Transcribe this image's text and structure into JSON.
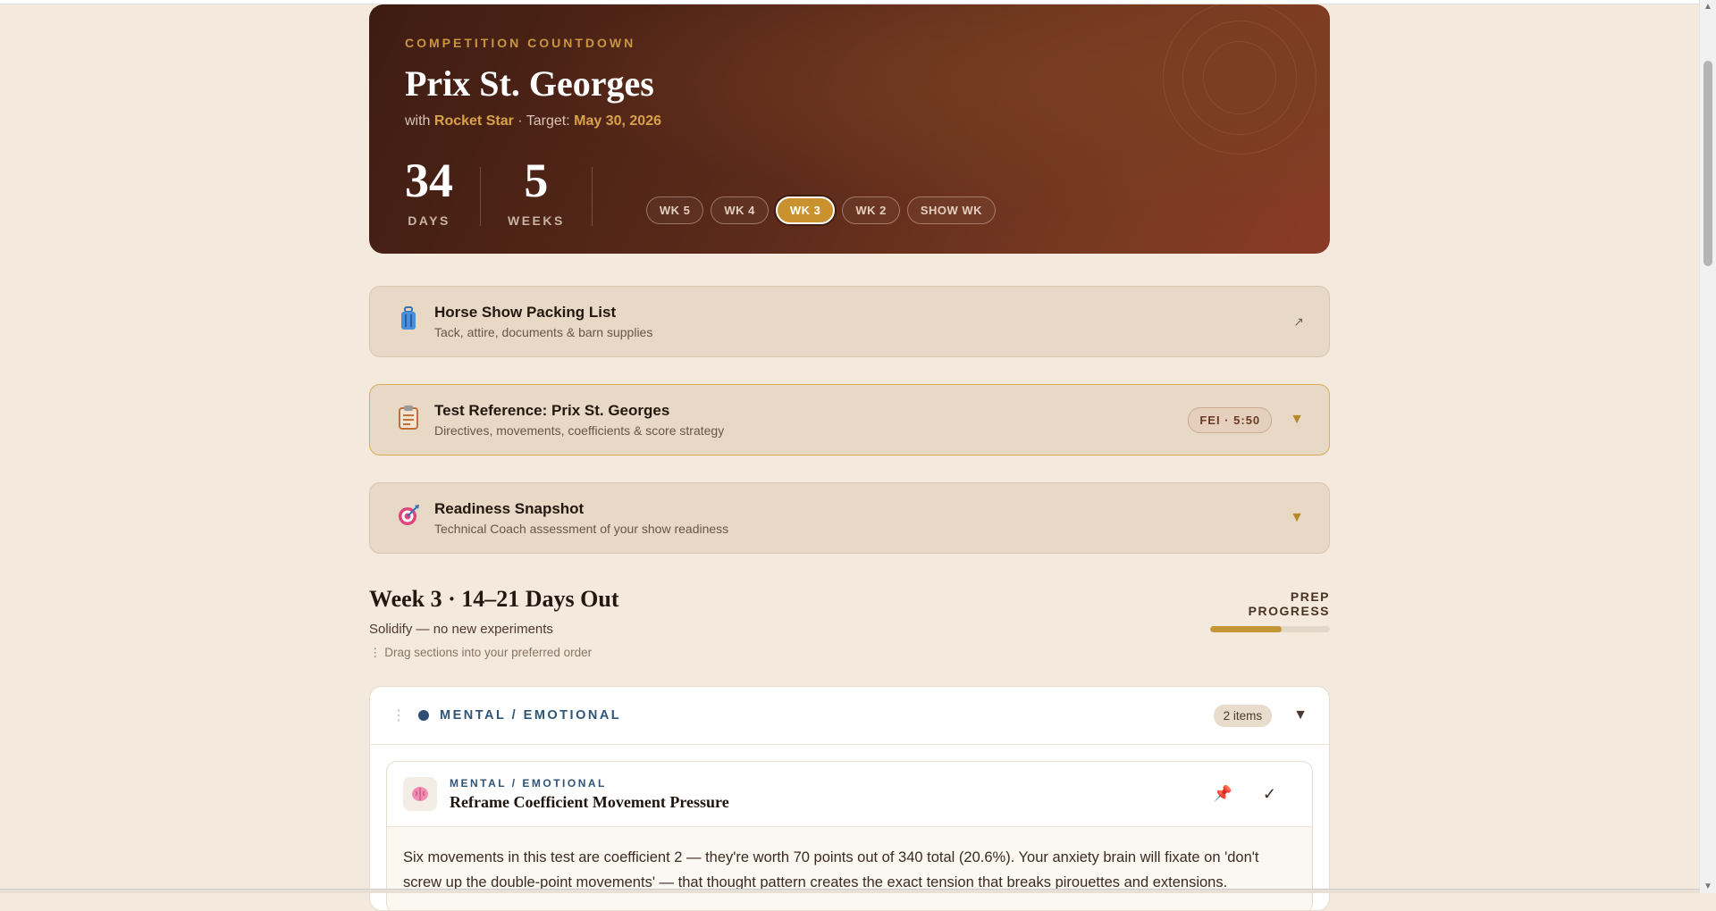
{
  "hero": {
    "eyebrow": "COMPETITION COUNTDOWN",
    "title": "Prix St. Georges",
    "with_label": "with",
    "horse": "Rocket Star",
    "sep_target": "· Target:",
    "target_date": "May 30, 2026",
    "days_value": "34",
    "days_label": "DAYS",
    "weeks_value": "5",
    "weeks_label": "WEEKS",
    "pills": [
      "WK 5",
      "WK 4",
      "WK 3",
      "WK 2",
      "SHOW WK"
    ],
    "active_pill": "WK 3"
  },
  "cards": {
    "packing": {
      "icon": "luggage-icon",
      "title": "Horse Show Packing List",
      "desc": "Tack, attire, documents & barn supplies",
      "arrow": "↗"
    },
    "test": {
      "icon": "clipboard-icon",
      "title": "Test Reference: Prix St. Georges",
      "desc": "Directives, movements, coefficients & score strategy",
      "badge": "FEI · 5:50",
      "caret": "▼"
    },
    "readiness": {
      "icon": "target-icon",
      "title": "Readiness Snapshot",
      "desc": "Technical Coach assessment of your show readiness",
      "caret": "▼"
    }
  },
  "week": {
    "title": "Week 3 · 14–21 Days Out",
    "subtitle": "Solidify — no new experiments",
    "drag_hint": "⋮ Drag sections into your preferred order",
    "progress_label": "PREP PROGRESS",
    "progress_fraction": 0.6
  },
  "section": {
    "title": "MENTAL / EMOTIONAL",
    "count": "2 items",
    "caret": "▼",
    "color": "#2e4f73",
    "item": {
      "icon": "brain-icon",
      "category": "MENTAL / EMOTIONAL",
      "title": "Reframe Coefficient Movement Pressure",
      "body": "Six movements in this test are coefficient 2 — they're worth 70 points out of 340 total (20.6%). Your anxiety brain will fixate on 'don't screw up the double-point movements' — that thought pattern creates the exact tension that breaks pirouettes and extensions."
    }
  },
  "colors": {
    "accent": "#c9922e",
    "hero_bg": "#5b2a1a",
    "page_bg": "#f3e9dc"
  }
}
